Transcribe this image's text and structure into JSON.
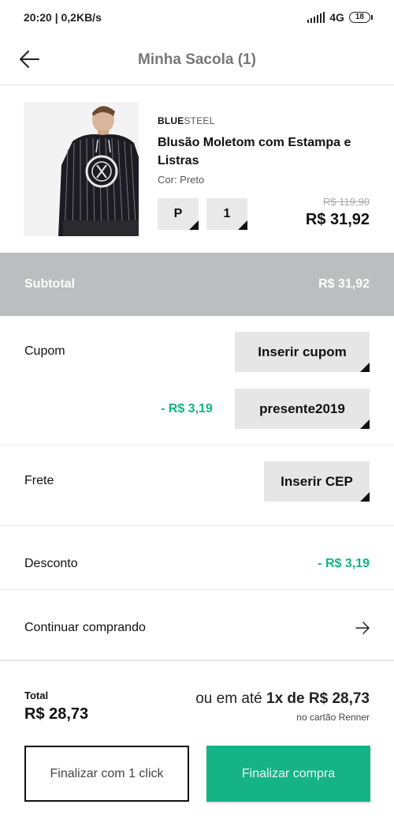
{
  "status_bar": {
    "time_speed": "20:20 | 0,2KB/s",
    "network": "4G",
    "battery": "18"
  },
  "header": {
    "title": "Minha Sacola (1)"
  },
  "product": {
    "brand_bold": "BLUE",
    "brand_light": "STEEL",
    "name": "Blusão Moletom com Estampa e Listras",
    "color": "Cor: Preto",
    "size": "P",
    "quantity": "1",
    "old_price": "R$ 119,90",
    "price": "R$ 31,92"
  },
  "subtotal": {
    "label": "Subtotal",
    "value": "R$ 31,92"
  },
  "coupon": {
    "label": "Cupom",
    "insert_button": "Inserir cupom",
    "discount": "- R$ 3,19",
    "code_button": "presente2019"
  },
  "shipping": {
    "label": "Frete",
    "insert_button": "Inserir CEP"
  },
  "discount": {
    "label": "Desconto",
    "value": "- R$ 3,19"
  },
  "continue": {
    "label": "Continuar comprando"
  },
  "total": {
    "label": "Total",
    "value": "R$ 28,73",
    "installment_prefix": "ou em até ",
    "installment_value": "1x de R$ 28,73",
    "installment_card": "no cartão Renner"
  },
  "actions": {
    "one_click": "Finalizar com 1 click",
    "buy": "Finalizar compra"
  },
  "colors": {
    "accent_green": "#16b384",
    "subtotal_bg": "#bbbdbf",
    "button_gray": "#e6e6e6"
  }
}
